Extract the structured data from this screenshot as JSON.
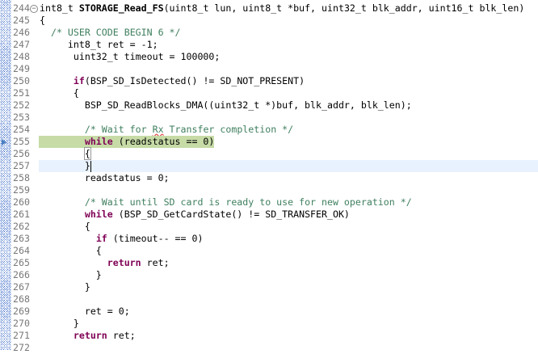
{
  "editor": {
    "highlight_line": 255,
    "current_line": 257,
    "colors": {
      "keyword": "#7f0055",
      "comment": "#3f7f5f",
      "highlight": "#c6dba6",
      "current_line": "#e8f2fe"
    },
    "lines": [
      {
        "n": "244",
        "fold": true,
        "seg": [
          [
            "int8_t ",
            ""
          ],
          [
            "STORAGE_Read_FS",
            "fn"
          ],
          [
            "(uint8_t lun, uint8_t *buf, uint32_t blk_addr, uint16_t blk_len)",
            ""
          ]
        ]
      },
      {
        "n": "245",
        "seg": [
          [
            "{",
            ""
          ]
        ]
      },
      {
        "n": "246",
        "seg": [
          [
            "  ",
            ""
          ],
          [
            "/* USER CODE BEGIN 6 */",
            "cm"
          ]
        ]
      },
      {
        "n": "247",
        "seg": [
          [
            "     int8_t ret = -1;",
            ""
          ]
        ]
      },
      {
        "n": "248",
        "seg": [
          [
            "      uint32_t timeout = 100000;",
            ""
          ]
        ]
      },
      {
        "n": "249",
        "seg": []
      },
      {
        "n": "250",
        "seg": [
          [
            "      ",
            ""
          ],
          [
            "if",
            "kw"
          ],
          [
            "(BSP_SD_IsDetected() != SD_NOT_PRESENT)",
            ""
          ]
        ]
      },
      {
        "n": "251",
        "seg": [
          [
            "      {",
            ""
          ]
        ]
      },
      {
        "n": "252",
        "seg": [
          [
            "        BSP_SD_ReadBlocks_DMA((uint32_t *)buf, blk_addr, blk_len);",
            ""
          ]
        ]
      },
      {
        "n": "253",
        "seg": []
      },
      {
        "n": "254",
        "seg": [
          [
            "        ",
            ""
          ],
          [
            "/* Wait for ",
            "cm"
          ],
          [
            "Rx",
            "cm sq"
          ],
          [
            " Transfer completion */",
            "cm"
          ]
        ]
      },
      {
        "n": "255",
        "arrow": true,
        "seg": [
          [
            "        ",
            ""
          ],
          [
            "while",
            "kw"
          ],
          [
            " (readstatus == 0)",
            ""
          ]
        ]
      },
      {
        "n": "256",
        "seg": [
          [
            "        ",
            ""
          ],
          [
            "{",
            "match"
          ]
        ]
      },
      {
        "n": "257",
        "caret": true,
        "seg": [
          [
            "        }",
            ""
          ]
        ]
      },
      {
        "n": "258",
        "seg": [
          [
            "        readstatus = 0;",
            ""
          ]
        ]
      },
      {
        "n": "259",
        "seg": []
      },
      {
        "n": "260",
        "seg": [
          [
            "        ",
            ""
          ],
          [
            "/* Wait until SD card is ready to use for new operation */",
            "cm"
          ]
        ]
      },
      {
        "n": "261",
        "seg": [
          [
            "        ",
            ""
          ],
          [
            "while",
            "kw"
          ],
          [
            " (BSP_SD_GetCardState() != SD_TRANSFER_OK)",
            ""
          ]
        ]
      },
      {
        "n": "262",
        "seg": [
          [
            "        {",
            ""
          ]
        ]
      },
      {
        "n": "263",
        "seg": [
          [
            "          ",
            ""
          ],
          [
            "if",
            "kw"
          ],
          [
            " (timeout-- == 0)",
            ""
          ]
        ]
      },
      {
        "n": "264",
        "seg": [
          [
            "          {",
            ""
          ]
        ]
      },
      {
        "n": "265",
        "seg": [
          [
            "            ",
            ""
          ],
          [
            "return",
            "kw"
          ],
          [
            " ret;",
            ""
          ]
        ]
      },
      {
        "n": "266",
        "seg": [
          [
            "          }",
            ""
          ]
        ]
      },
      {
        "n": "267",
        "seg": [
          [
            "        }",
            ""
          ]
        ]
      },
      {
        "n": "268",
        "seg": []
      },
      {
        "n": "269",
        "seg": [
          [
            "        ret = 0;",
            ""
          ]
        ]
      },
      {
        "n": "270",
        "seg": [
          [
            "      }",
            ""
          ]
        ]
      },
      {
        "n": "271",
        "seg": [
          [
            "      ",
            ""
          ],
          [
            "return",
            "kw"
          ],
          [
            " ret;",
            ""
          ]
        ]
      },
      {
        "n": "272",
        "seg": []
      }
    ]
  }
}
